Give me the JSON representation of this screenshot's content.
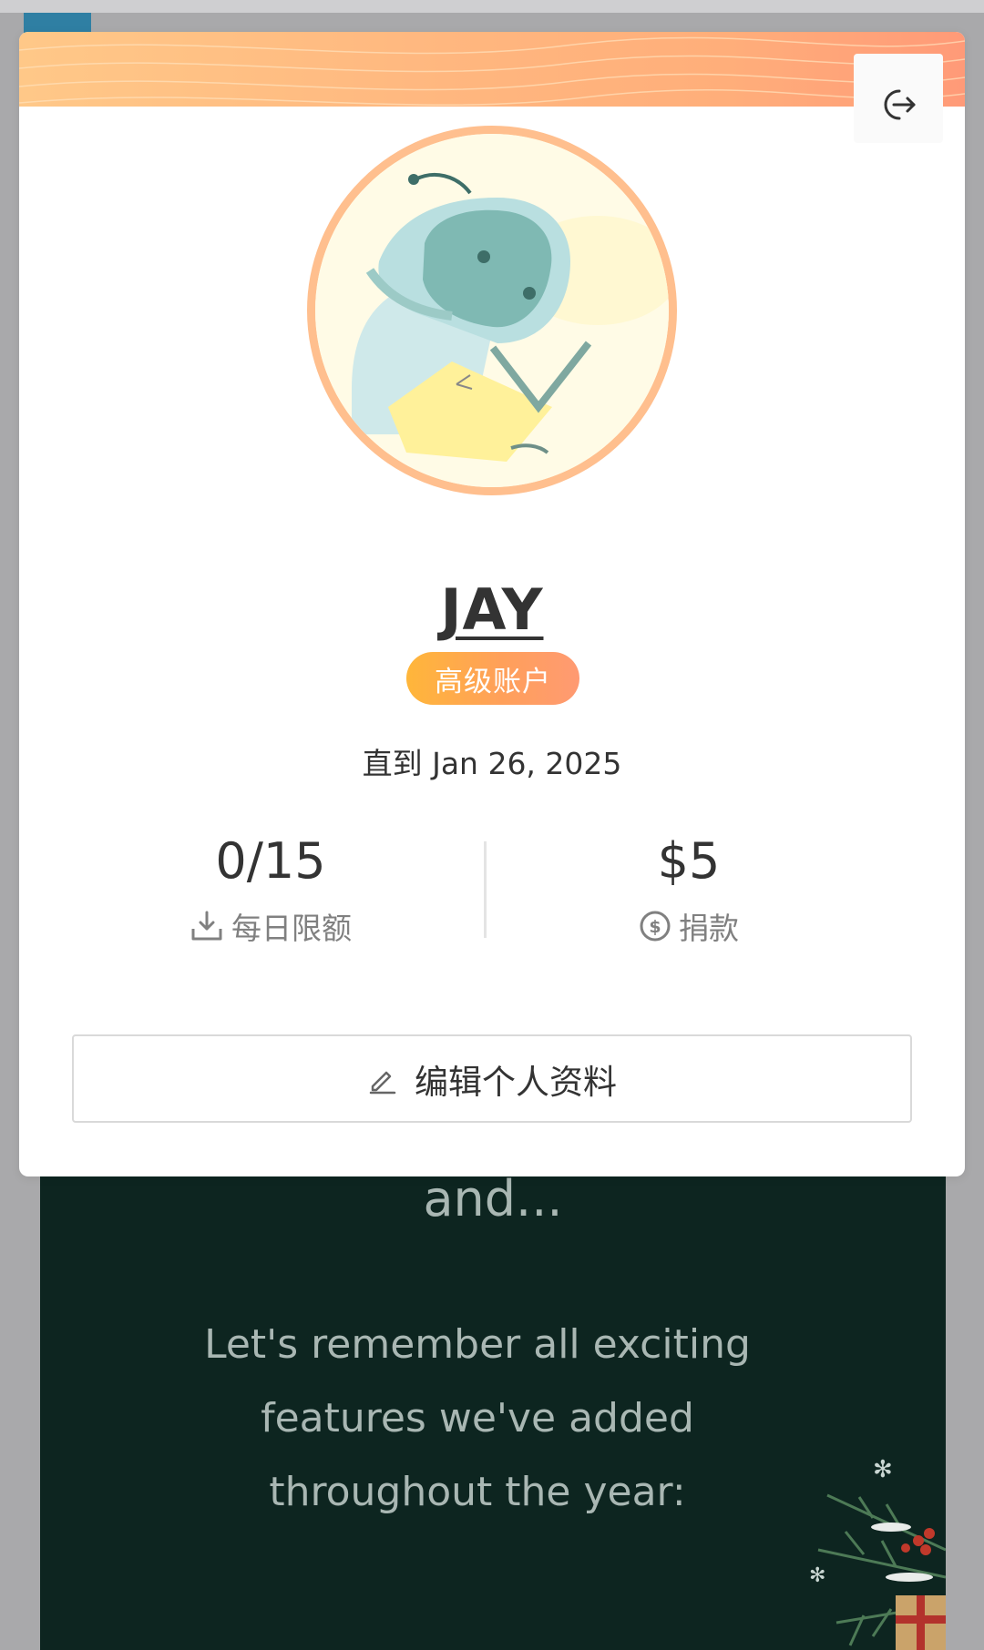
{
  "background": {
    "heading": "and...",
    "paragraph": "Let's remember all exciting features we've added throughout the year:"
  },
  "profile": {
    "username": "JAY",
    "tier_label": "高级账户",
    "expiry_text": "直到 Jan 26, 2025",
    "stats": {
      "daily_limit": {
        "value": "0/15",
        "label": "每日限额",
        "icon": "download-icon"
      },
      "donation": {
        "value": "$5",
        "label": "捐款",
        "icon": "dollar-circle-icon"
      }
    },
    "edit_button_label": "编辑个人资料",
    "logout_icon": "logout-icon"
  },
  "colors": {
    "banner_start": "#ffc888",
    "banner_end": "#ff9a78",
    "badge_start": "#ffb63a",
    "badge_end": "#ff9a72",
    "avatar_ring": "#ffbf8e",
    "background_panel": "#0d2520"
  }
}
